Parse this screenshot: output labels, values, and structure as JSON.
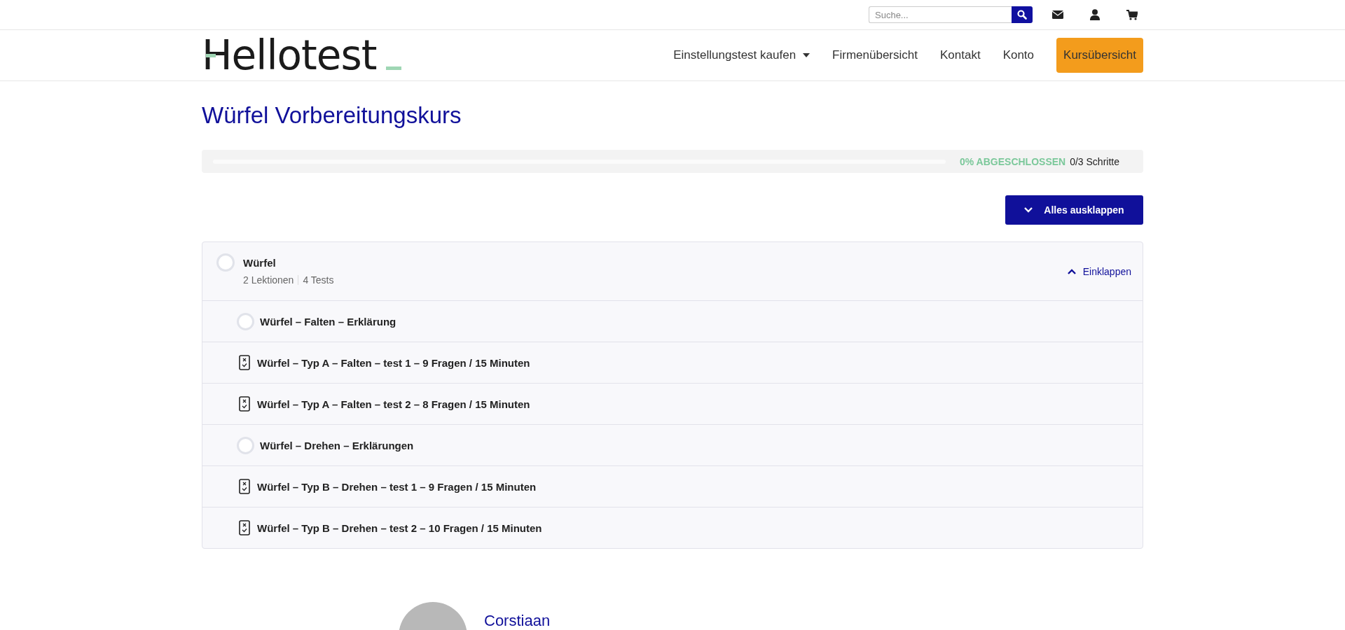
{
  "top_bar": {
    "search": {
      "placeholder": "Suche..."
    }
  },
  "header": {
    "logo": "Hellotest",
    "nav": [
      {
        "label": "Einstellungstest kaufen",
        "kind": "dropdown"
      },
      {
        "label": "Firmenübersicht",
        "kind": "link"
      },
      {
        "label": "Kontakt",
        "kind": "link"
      },
      {
        "label": "Konto",
        "kind": "link"
      },
      {
        "label": "Kursübersicht",
        "kind": "button"
      }
    ]
  },
  "course": {
    "title": "Würfel Vorbereitungskurs",
    "progress": {
      "level": 0,
      "percent_label": "0% ABGESCHLOSSEN",
      "steps": "0/3 Schritte"
    },
    "expand_all": "Alles ausklappen",
    "sections": [
      {
        "title": "Würfel",
        "completed": false,
        "expanded": true,
        "lessons_count": "2 Lektionen",
        "tests_count": "4 Tests",
        "toggle": "Einklappen",
        "items": [
          {
            "kind": "lesson",
            "title": "Würfel – Falten – Erklärung",
            "completed": false
          },
          {
            "kind": "test",
            "title": "Würfel – Typ A – Falten – test 1 – 9 Fragen / 15 Minuten"
          },
          {
            "kind": "test",
            "title": "Würfel – Typ A – Falten – test 2 – 8 Fragen / 15 Minuten"
          },
          {
            "kind": "lesson",
            "title": "Würfel – Drehen – Erklärungen",
            "completed": false
          },
          {
            "kind": "test",
            "title": "Würfel – Typ B – Drehen – test 1 – 9 Fragen / 15 Minuten"
          },
          {
            "kind": "test",
            "title": "Würfel – Typ B – Drehen – test 2 – 10 Fragen / 15 Minuten"
          }
        ]
      }
    ]
  },
  "author": {
    "name": "Corstiaan"
  }
}
